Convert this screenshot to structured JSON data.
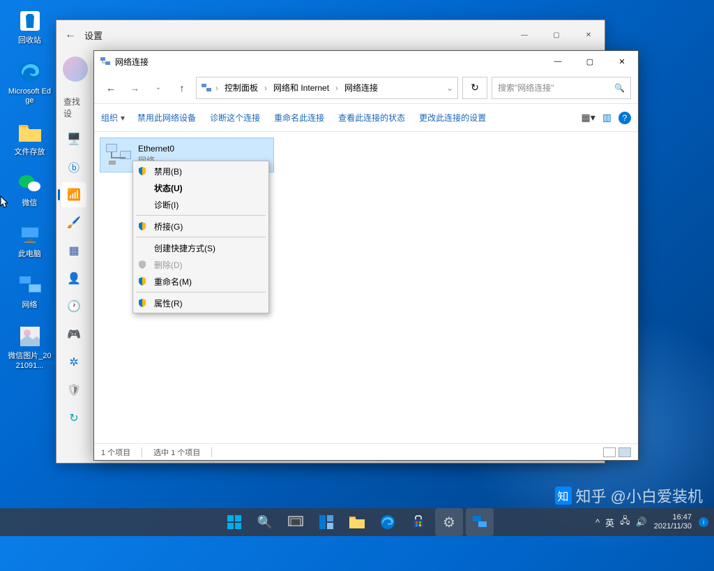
{
  "desktop": {
    "icons": [
      {
        "label": "回收站"
      },
      {
        "label": "Microsoft Edge"
      },
      {
        "label": "文件存放"
      },
      {
        "label": "微信"
      },
      {
        "label": "此电脑"
      },
      {
        "label": "网络"
      },
      {
        "label": "微信图片_2021091..."
      }
    ]
  },
  "settings": {
    "title": "设置",
    "search": "查找设",
    "min": "—",
    "max": "▢",
    "close": "✕"
  },
  "explorer": {
    "title": "网络连接",
    "breadcrumb": {
      "root": "控制面板",
      "sub": "网络和 Internet",
      "leaf": "网络连接"
    },
    "search_placeholder": "搜索\"网络连接\"",
    "toolbar": {
      "org": "组织",
      "disable": "禁用此网络设备",
      "diagnose": "诊断这个连接",
      "rename": "重命名此连接",
      "status": "查看此连接的状态",
      "change": "更改此连接的设置"
    },
    "connection": {
      "name": "Ethernet0",
      "sub": "网络"
    },
    "status_left": "1 个项目",
    "status_sel": "选中 1 个项目"
  },
  "ctx": {
    "disable": "禁用(B)",
    "status": "状态(U)",
    "diagnose": "诊断(I)",
    "bridge": "桥接(G)",
    "shortcut": "创建快捷方式(S)",
    "delete": "删除(D)",
    "rename": "重命名(M)",
    "properties": "属性(R)"
  },
  "tray": {
    "chevron": "^",
    "ime": "英",
    "time": "16:47",
    "date": "2021/11/30"
  },
  "watermark": "知乎 @小白爱装机"
}
